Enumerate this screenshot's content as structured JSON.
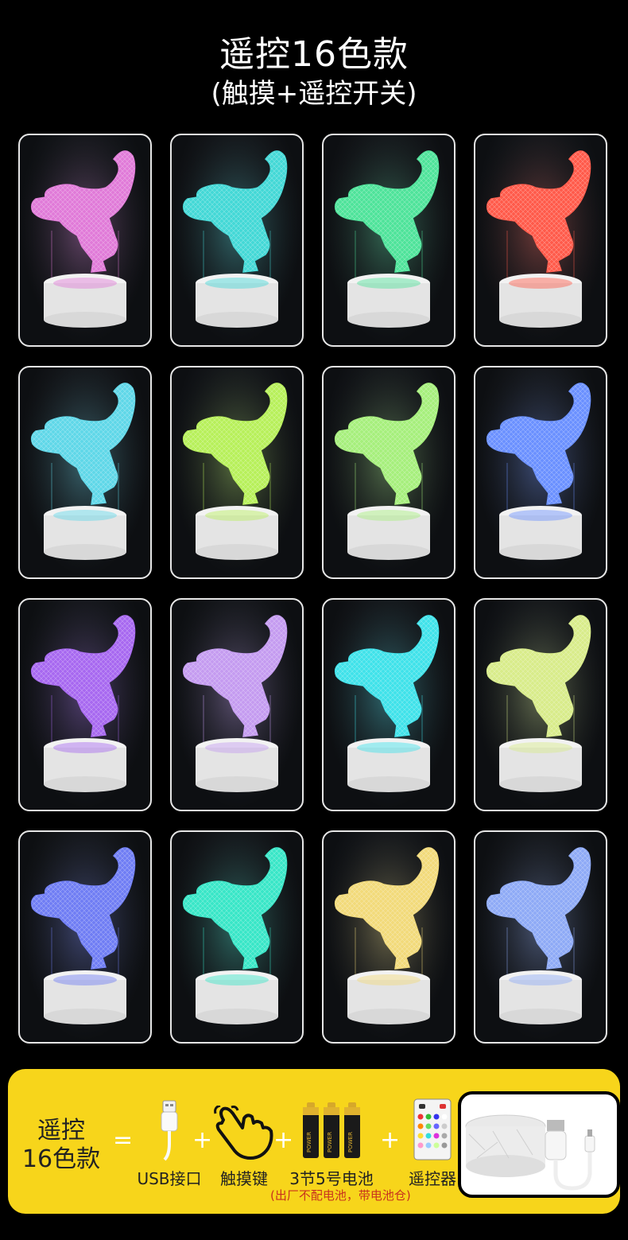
{
  "title": "遥控16色款",
  "subtitle": "(触摸+遥控开关)",
  "lamps": [
    {
      "color": "#e07ad8"
    },
    {
      "color": "#43d8d6"
    },
    {
      "color": "#4ee39a"
    },
    {
      "color": "#ff5a4a"
    },
    {
      "color": "#5fd7e8"
    },
    {
      "color": "#b7f05a"
    },
    {
      "color": "#a6ef7c"
    },
    {
      "color": "#6a90ff"
    },
    {
      "color": "#a768f0"
    },
    {
      "color": "#c49bf0"
    },
    {
      "color": "#3fe2ea"
    },
    {
      "color": "#d8ec8a"
    },
    {
      "color": "#6f7df4"
    },
    {
      "color": "#38e6c7"
    },
    {
      "color": "#f2da7a"
    },
    {
      "color": "#8eaaf6"
    }
  ],
  "bottom": {
    "label_line1": "遥控",
    "label_line2": "16色款",
    "equals": "=",
    "plus": "+",
    "items": [
      {
        "label": "USB接口",
        "icon": "usb-connector-icon"
      },
      {
        "label": "触摸键",
        "icon": "touch-hand-icon"
      },
      {
        "label": "3节5号电池",
        "icon": "aa-batteries-icon"
      },
      {
        "label": "遥控器",
        "icon": "remote-control-icon"
      }
    ],
    "battery_text": "POWER",
    "note": "(出厂不配电池，带电池仓)"
  },
  "accent_color": "#f7d51b"
}
